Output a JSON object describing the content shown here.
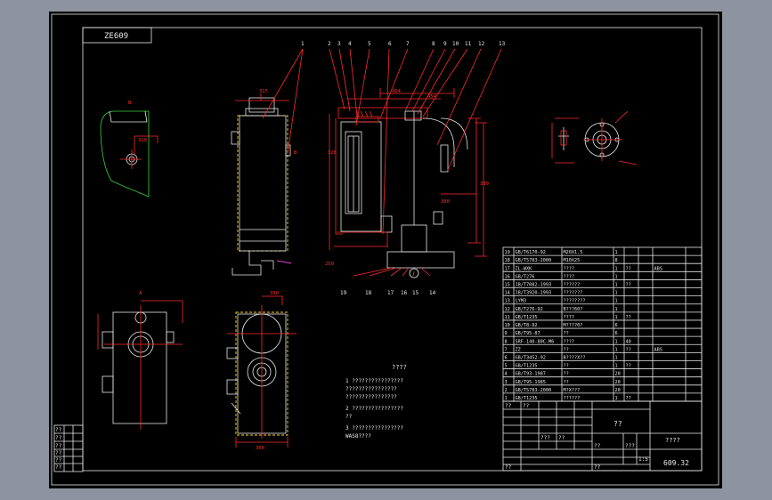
{
  "drawing": {
    "number_box": "ZE609",
    "notes_title": "????",
    "notes": [
      "1  ????????????????",
      "   ????????????????",
      "   ????????????????",
      "2  ????????????????",
      "   ??",
      "3  ????????????????",
      "   WAS8????"
    ],
    "balloons": [
      "1",
      "2",
      "3",
      "4",
      "5",
      "6",
      "7",
      "8",
      "9",
      "10",
      "11",
      "12",
      "13"
    ],
    "bottom_balloons": [
      "19",
      "18",
      "17",
      "16",
      "15",
      "14"
    ],
    "top_dims": [
      "454",
      "454"
    ],
    "side_dims": [
      "380",
      "320",
      "250",
      "300"
    ],
    "view_a_label": "A",
    "view_b_label": "B",
    "bottom_width_dim": "300",
    "left_view_dim": "310",
    "front_top_dim": "315",
    "bottom_view_top_dim": "390"
  },
  "parts": [
    [
      "19",
      "GB/T6170-92",
      "M20X1.5",
      "1"
    ],
    [
      "18",
      "GB/T5783-2000",
      "M10X25",
      "8"
    ],
    [
      "17",
      "ZL-WXK",
      "????",
      "1",
      "??",
      "",
      "ABS"
    ],
    [
      "16",
      "GB/T276",
      "????",
      "1"
    ],
    [
      "15",
      "JB/T7082-1993",
      "??????",
      "1",
      "??"
    ],
    [
      "14",
      "JB/T3920-1993",
      "???????",
      "1"
    ],
    [
      "13",
      "LYM3",
      "????????",
      "1"
    ],
    [
      "12",
      "GB/T276-92",
      "B???60?",
      "1"
    ],
    [
      "11",
      "GB/T1235",
      "????",
      "1",
      "??"
    ],
    [
      "10",
      "GB/T8-92",
      "M????0?",
      "6"
    ],
    [
      "9",
      "GB/T95-87",
      "??",
      "6"
    ],
    [
      "8",
      "SRF-140-80C-M6",
      "????",
      "1",
      "40",
      ""
    ],
    [
      "7",
      "ZZ",
      "??",
      "1",
      "??",
      "",
      "ABS"
    ],
    [
      "6",
      "GB/T3452-92",
      "B????X??",
      "1"
    ],
    [
      "5",
      "GB/T1235",
      "??",
      "1",
      "??"
    ],
    [
      "4",
      "GB/T93-1987",
      "??",
      "20"
    ],
    [
      "3",
      "GB/T95-1985",
      "??",
      "20"
    ],
    [
      "2",
      "GB/T5783-2000",
      "M?X???",
      "20"
    ],
    [
      "1",
      "GB/T1235",
      "??????",
      "1",
      "??"
    ]
  ],
  "title_block": {
    "name": "??",
    "material": "????",
    "drawing_no": "609.32",
    "scale": "1:5",
    "small_cells": [
      "??",
      "??",
      "???",
      "??",
      "??",
      "???",
      "??",
      "??"
    ]
  },
  "left_table": [
    "??",
    "??",
    "??",
    "??",
    "??",
    "??"
  ]
}
